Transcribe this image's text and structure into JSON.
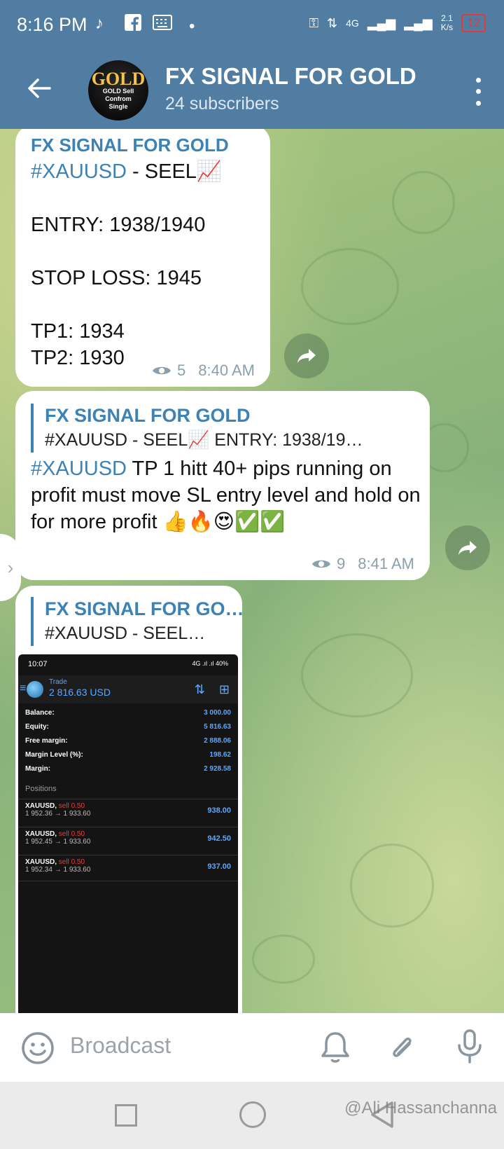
{
  "status_bar": {
    "time": "8:16 PM",
    "network": "4G",
    "speed": "2.1",
    "speed_unit": "K/s",
    "battery": "12"
  },
  "header": {
    "title": "FX SIGNAL FOR GOLD",
    "subtitle": "24 subscribers",
    "avatar_big": "GOLD",
    "avatar_small": "GOLD Sell\nConfrom\nSingle"
  },
  "messages": [
    {
      "channel": "FX SIGNAL FOR GOLD",
      "hashtag": "#XAUUSD",
      "text_after_hashtag": "   - SEEL📈",
      "body": "\nENTRY:  1938/1940\n\nSTOP LOSS: 1945\n\nTP1:  1934\nTP2:  1930",
      "views": "5",
      "time": "8:40 AM"
    },
    {
      "reply_title": "FX SIGNAL FOR GOLD",
      "reply_snippet": "#XAUUSD   - SEEL📈      ENTRY:  1938/19…",
      "hashtag": "#XAUUSD",
      "body": "  TP 1  hitt 40+ pips running on profit must move SL entry level and hold on for more profit 👍🔥😍✅✅",
      "views": "9",
      "time": "8:41 AM"
    },
    {
      "reply_title": "FX SIGNAL FOR GO…",
      "reply_snippet": "#XAUUSD   - SEEL…",
      "screenshot": {
        "time": "10:07",
        "status": "4G .ıl .ıl 40%",
        "trade_label": "Trade",
        "trade_value": "2 816.63 USD",
        "rows": [
          {
            "label": "Balance:",
            "value": "3 000.00"
          },
          {
            "label": "Equity:",
            "value": "5 816.63"
          },
          {
            "label": "Free margin:",
            "value": "2 888.06"
          },
          {
            "label": "Margin Level (%):",
            "value": "198.62"
          },
          {
            "label": "Margin:",
            "value": "2 928.58"
          }
        ],
        "positions_label": "Positions",
        "positions": [
          {
            "symbol": "XAUUSD,",
            "side": "sell 0.50",
            "prices": "1 952.36 → 1 933.60",
            "profit": "938.00"
          },
          {
            "symbol": "XAUUSD,",
            "side": "sell 0.50",
            "prices": "1 952.45 → 1 933.60",
            "profit": "942.50"
          },
          {
            "symbol": "XAUUSD,",
            "side": "sell 0.50",
            "prices": "1 952.34 → 1 933.60",
            "profit": "937.00"
          }
        ]
      }
    }
  ],
  "input": {
    "placeholder": "Broadcast"
  },
  "watermark": "@Ali Hassanchanna",
  "colors": {
    "header": "#517da2",
    "link": "#3c82b5"
  }
}
